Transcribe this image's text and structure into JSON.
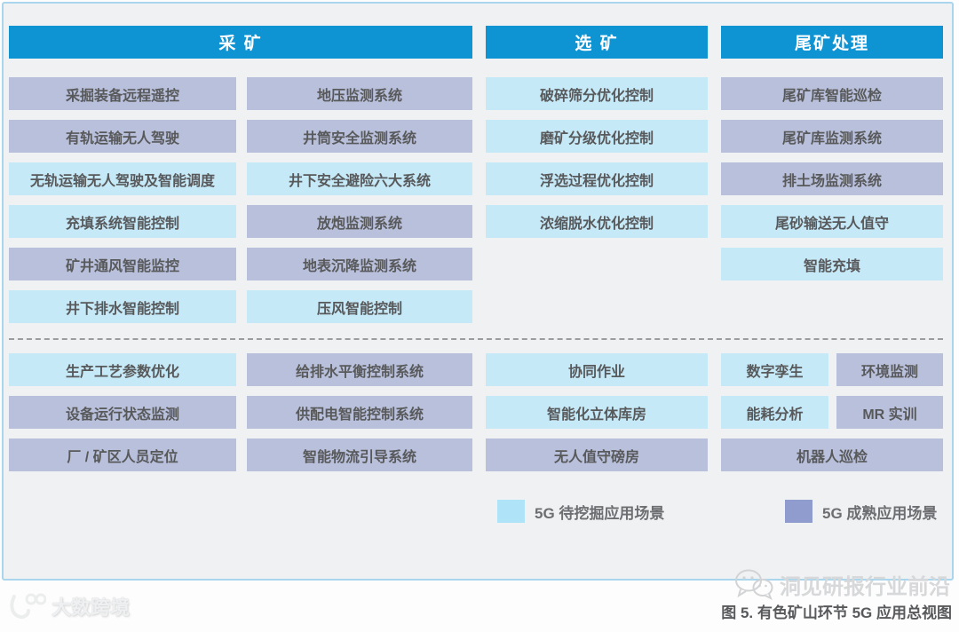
{
  "headers": [
    {
      "label": "采 矿"
    },
    {
      "label": "选 矿"
    },
    {
      "label": "尾矿处理"
    }
  ],
  "top_section": {
    "columns": [
      {
        "items": [
          {
            "label": "采掘装备远程遥控",
            "status": "mature"
          },
          {
            "label": "有轨运输无人驾驶",
            "status": "mature"
          },
          {
            "label": "无轨运输无人驾驶及智能调度",
            "status": "potential"
          },
          {
            "label": "充填系统智能控制",
            "status": "potential"
          },
          {
            "label": "矿井通风智能监控",
            "status": "mature"
          },
          {
            "label": "井下排水智能控制",
            "status": "potential"
          }
        ]
      },
      {
        "items": [
          {
            "label": "地压监测系统",
            "status": "mature"
          },
          {
            "label": "井筒安全监测系统",
            "status": "mature"
          },
          {
            "label": "井下安全避险六大系统",
            "status": "potential"
          },
          {
            "label": "放炮监测系统",
            "status": "mature"
          },
          {
            "label": "地表沉降监测系统",
            "status": "mature"
          },
          {
            "label": "压风智能控制",
            "status": "potential"
          }
        ]
      },
      {
        "items": [
          {
            "label": "破碎筛分优化控制",
            "status": "potential"
          },
          {
            "label": "磨矿分级优化控制",
            "status": "potential"
          },
          {
            "label": "浮选过程优化控制",
            "status": "potential"
          },
          {
            "label": "浓缩脱水优化控制",
            "status": "potential"
          }
        ]
      },
      {
        "items": [
          {
            "label": "尾矿库智能巡检",
            "status": "mature"
          },
          {
            "label": "尾矿库监测系统",
            "status": "mature"
          },
          {
            "label": "排土场监测系统",
            "status": "mature"
          },
          {
            "label": "尾砂输送无人值守",
            "status": "potential"
          },
          {
            "label": "智能充填",
            "status": "potential"
          }
        ]
      }
    ]
  },
  "bottom_section": {
    "columns": [
      {
        "rows": [
          [
            {
              "label": "生产工艺参数优化",
              "status": "potential"
            }
          ],
          [
            {
              "label": "设备运行状态监测",
              "status": "mature"
            }
          ],
          [
            {
              "label": "厂 / 矿区人员定位",
              "status": "mature"
            }
          ]
        ]
      },
      {
        "rows": [
          [
            {
              "label": "给排水平衡控制系统",
              "status": "mature"
            }
          ],
          [
            {
              "label": "供配电智能控制系统",
              "status": "mature"
            }
          ],
          [
            {
              "label": "智能物流引导系统",
              "status": "mature"
            }
          ]
        ]
      },
      {
        "rows": [
          [
            {
              "label": "协同作业",
              "status": "potential"
            }
          ],
          [
            {
              "label": "智能化立体库房",
              "status": "potential"
            }
          ],
          [
            {
              "label": "无人值守磅房",
              "status": "mature"
            }
          ]
        ]
      },
      {
        "rows": [
          [
            {
              "label": "数字孪生",
              "status": "potential"
            },
            {
              "label": "环境监测",
              "status": "mature"
            }
          ],
          [
            {
              "label": "能耗分析",
              "status": "potential"
            },
            {
              "label": "MR 实训",
              "status": "mature"
            }
          ],
          [
            {
              "label": "机器人巡检",
              "status": "mature"
            }
          ]
        ]
      }
    ]
  },
  "legend": [
    {
      "label": "5G 待挖掘应用场景",
      "status": "potential",
      "color": "#aee3f8"
    },
    {
      "label": "5G 成熟应用场景",
      "status": "mature",
      "color": "#8f9ccd"
    }
  ],
  "caption": "图 5. 有色矿山环节 5G 应用总视图",
  "watermarks": {
    "right_text": "洞见研报行业前沿",
    "left_text": "大数跨境"
  },
  "colors": {
    "header_bg": "#0e93d3",
    "item_mature": "#b9c0db",
    "item_potential": "#c6e9f8",
    "legend_mature": "#8f9ccd",
    "legend_potential": "#aee3f8",
    "panel_border": "#a9d6ec",
    "panel_bg": "#f0f1f2",
    "item_text": "#58595b"
  }
}
